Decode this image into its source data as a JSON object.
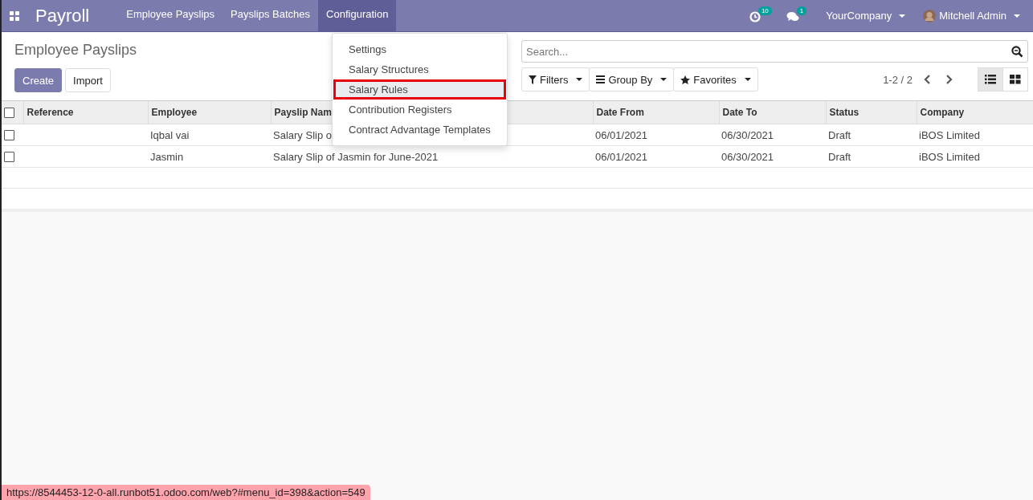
{
  "navbar": {
    "app_title": "Payroll",
    "menu": [
      {
        "label": "Employee Payslips",
        "selected": false
      },
      {
        "label": "Payslips Batches",
        "selected": false
      },
      {
        "label": "Configuration",
        "selected": true
      }
    ],
    "activity_count": "10",
    "message_count": "1",
    "company": "YourCompany",
    "user": "Mitchell Admin"
  },
  "config_menu": {
    "items": [
      {
        "label": "Settings",
        "selected": false
      },
      {
        "label": "Salary Structures",
        "selected": false
      },
      {
        "label": "Salary Rules",
        "selected": true
      },
      {
        "label": "Contribution Registers",
        "selected": false
      },
      {
        "label": "Contract Advantage Templates",
        "selected": false
      }
    ]
  },
  "control_panel": {
    "title": "Employee Payslips",
    "buttons": [
      "Create",
      "Import"
    ],
    "search": {
      "placeholder": "Search..."
    },
    "filters": [
      {
        "kind": "filter",
        "label": "Filters"
      },
      {
        "kind": "group",
        "label": "Group By"
      },
      {
        "kind": "star",
        "label": "Favorites"
      }
    ],
    "pager": "1-2 / 2",
    "views": [
      {
        "kind": "list",
        "selected": true
      },
      {
        "kind": "kanban",
        "selected": false
      }
    ]
  },
  "table": {
    "all_checked": false,
    "columns": [
      "Reference",
      "Employee",
      "Payslip Nam",
      "Date From",
      "Date To",
      "Status",
      "Company"
    ],
    "rows": [
      {
        "checked": false,
        "cells": [
          "",
          "Iqbal vai",
          "Salary Slip o",
          "06/01/2021",
          "06/30/2021",
          "Draft",
          "iBOS Limited"
        ]
      },
      {
        "checked": false,
        "cells": [
          "",
          "Jasmin",
          "Salary Slip of Jasmin for June-2021",
          "06/01/2021",
          "06/30/2021",
          "Draft",
          "iBOS Limited"
        ]
      }
    ]
  },
  "status_url": "https://8544453-12-0-all.runbot51.odoo.com/web?#menu_id=398&action=549"
}
